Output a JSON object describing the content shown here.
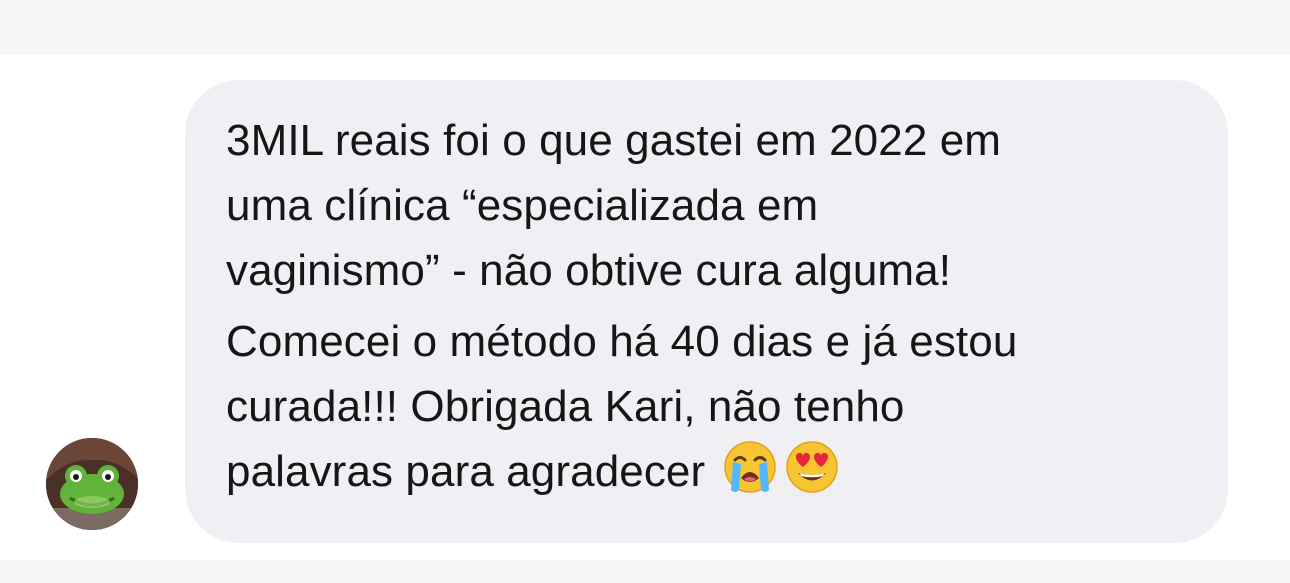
{
  "message": {
    "paragraphs": [
      {
        "lines": [
          "3MIL reais foi o que gastei em 2022 em",
          "uma clínica “especializada em",
          "vaginismo” - não obtive cura alguma!"
        ]
      },
      {
        "lines": [
          "Comecei o método há 40 dias e já estou",
          "curada!!! Obrigada Kari, não tenho",
          "palavras para agradecer"
        ]
      }
    ],
    "emojis": [
      "loudly-crying-face-icon",
      "heart-eyes-face-icon"
    ],
    "bubble_color": "#efeff4",
    "text_color": "#161616"
  },
  "avatar": {
    "icon": "frog-avatar-icon"
  },
  "colors": {
    "background": "#ffffff",
    "strip": "#f6f6f8"
  }
}
